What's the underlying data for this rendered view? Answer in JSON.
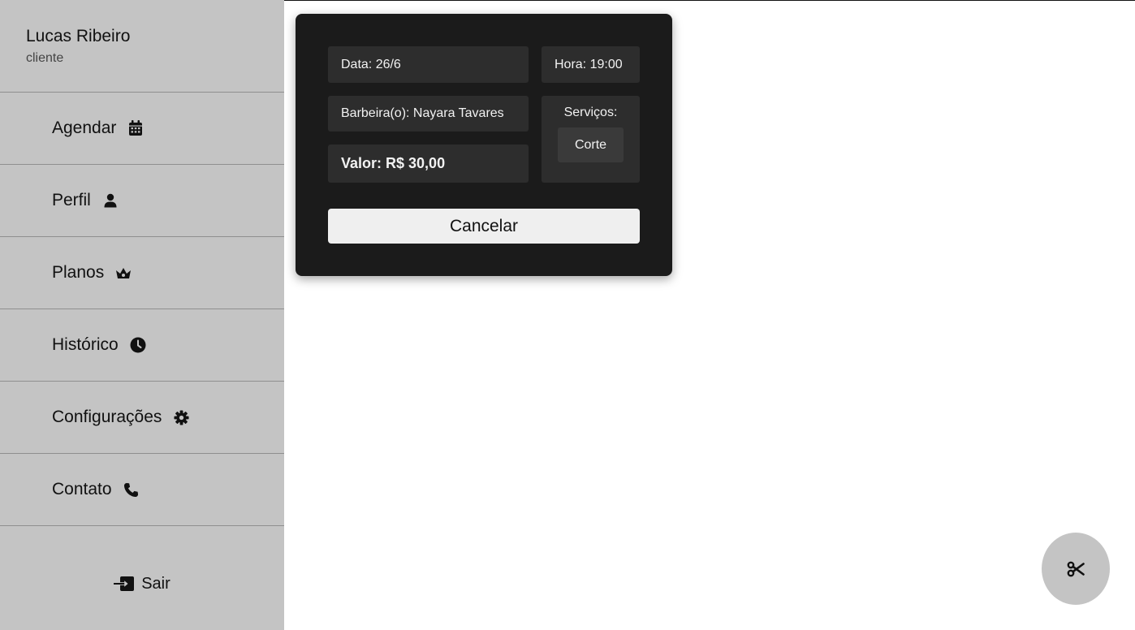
{
  "user": {
    "name": "Lucas Ribeiro",
    "role": "cliente"
  },
  "nav": {
    "items": [
      {
        "label": "Agendar",
        "icon": "calendar-icon"
      },
      {
        "label": "Perfil",
        "icon": "user-icon"
      },
      {
        "label": "Planos",
        "icon": "crown-icon"
      },
      {
        "label": "Histórico",
        "icon": "clock-icon"
      },
      {
        "label": "Configurações",
        "icon": "gear-icon"
      },
      {
        "label": "Contato",
        "icon": "phone-icon"
      }
    ],
    "logout": {
      "label": "Sair",
      "icon": "sign-in-icon"
    }
  },
  "appointment": {
    "date": "Data: 26/6",
    "hour": "Hora: 19:00",
    "barber": "Barbeira(o): Nayara Tavares",
    "value": "Valor: R$ 30,00",
    "services_title": "Serviços:",
    "services": [
      "Corte"
    ],
    "cancel_label": "Cancelar"
  },
  "fab": {
    "icon": "scissors-icon"
  },
  "colors": {
    "sidebar_bg": "#c4c4c4",
    "card_bg": "#1b1b1b",
    "field_bg": "#2d2d2d",
    "button_bg": "#efefef"
  }
}
